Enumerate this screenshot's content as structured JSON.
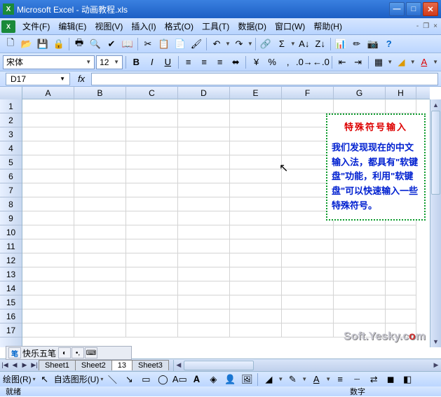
{
  "title": "Microsoft Excel - 动画教程.xls",
  "menu": [
    "文件(F)",
    "编辑(E)",
    "视图(V)",
    "插入(I)",
    "格式(O)",
    "工具(T)",
    "数据(D)",
    "窗口(W)",
    "帮助(H)"
  ],
  "font": {
    "name": "宋体",
    "size": "12"
  },
  "namebox": "D17",
  "columns": [
    "A",
    "B",
    "C",
    "D",
    "E",
    "F",
    "G",
    "H"
  ],
  "rows": [
    "1",
    "2",
    "3",
    "4",
    "5",
    "6",
    "7",
    "8",
    "9",
    "10",
    "11",
    "12",
    "13",
    "14",
    "15",
    "16",
    "17"
  ],
  "callout": {
    "title": "特殊符号输入",
    "body": "我们发现现在的中文输入法，都具有\"软键盘\"功能，利用\"软键盘\"可以快速输入一些特殊符号。"
  },
  "ime": "快乐五笔",
  "sheets": [
    "Sheet1",
    "Sheet2",
    "13",
    "Sheet3"
  ],
  "draw": {
    "label": "绘图(R)",
    "autoshape": "自选图形(U)"
  },
  "status": {
    "left": "就绪",
    "right": "数字"
  },
  "watermark": {
    "p1": "Soft.Yesky.c",
    "p2": "o",
    "p3": "m"
  }
}
